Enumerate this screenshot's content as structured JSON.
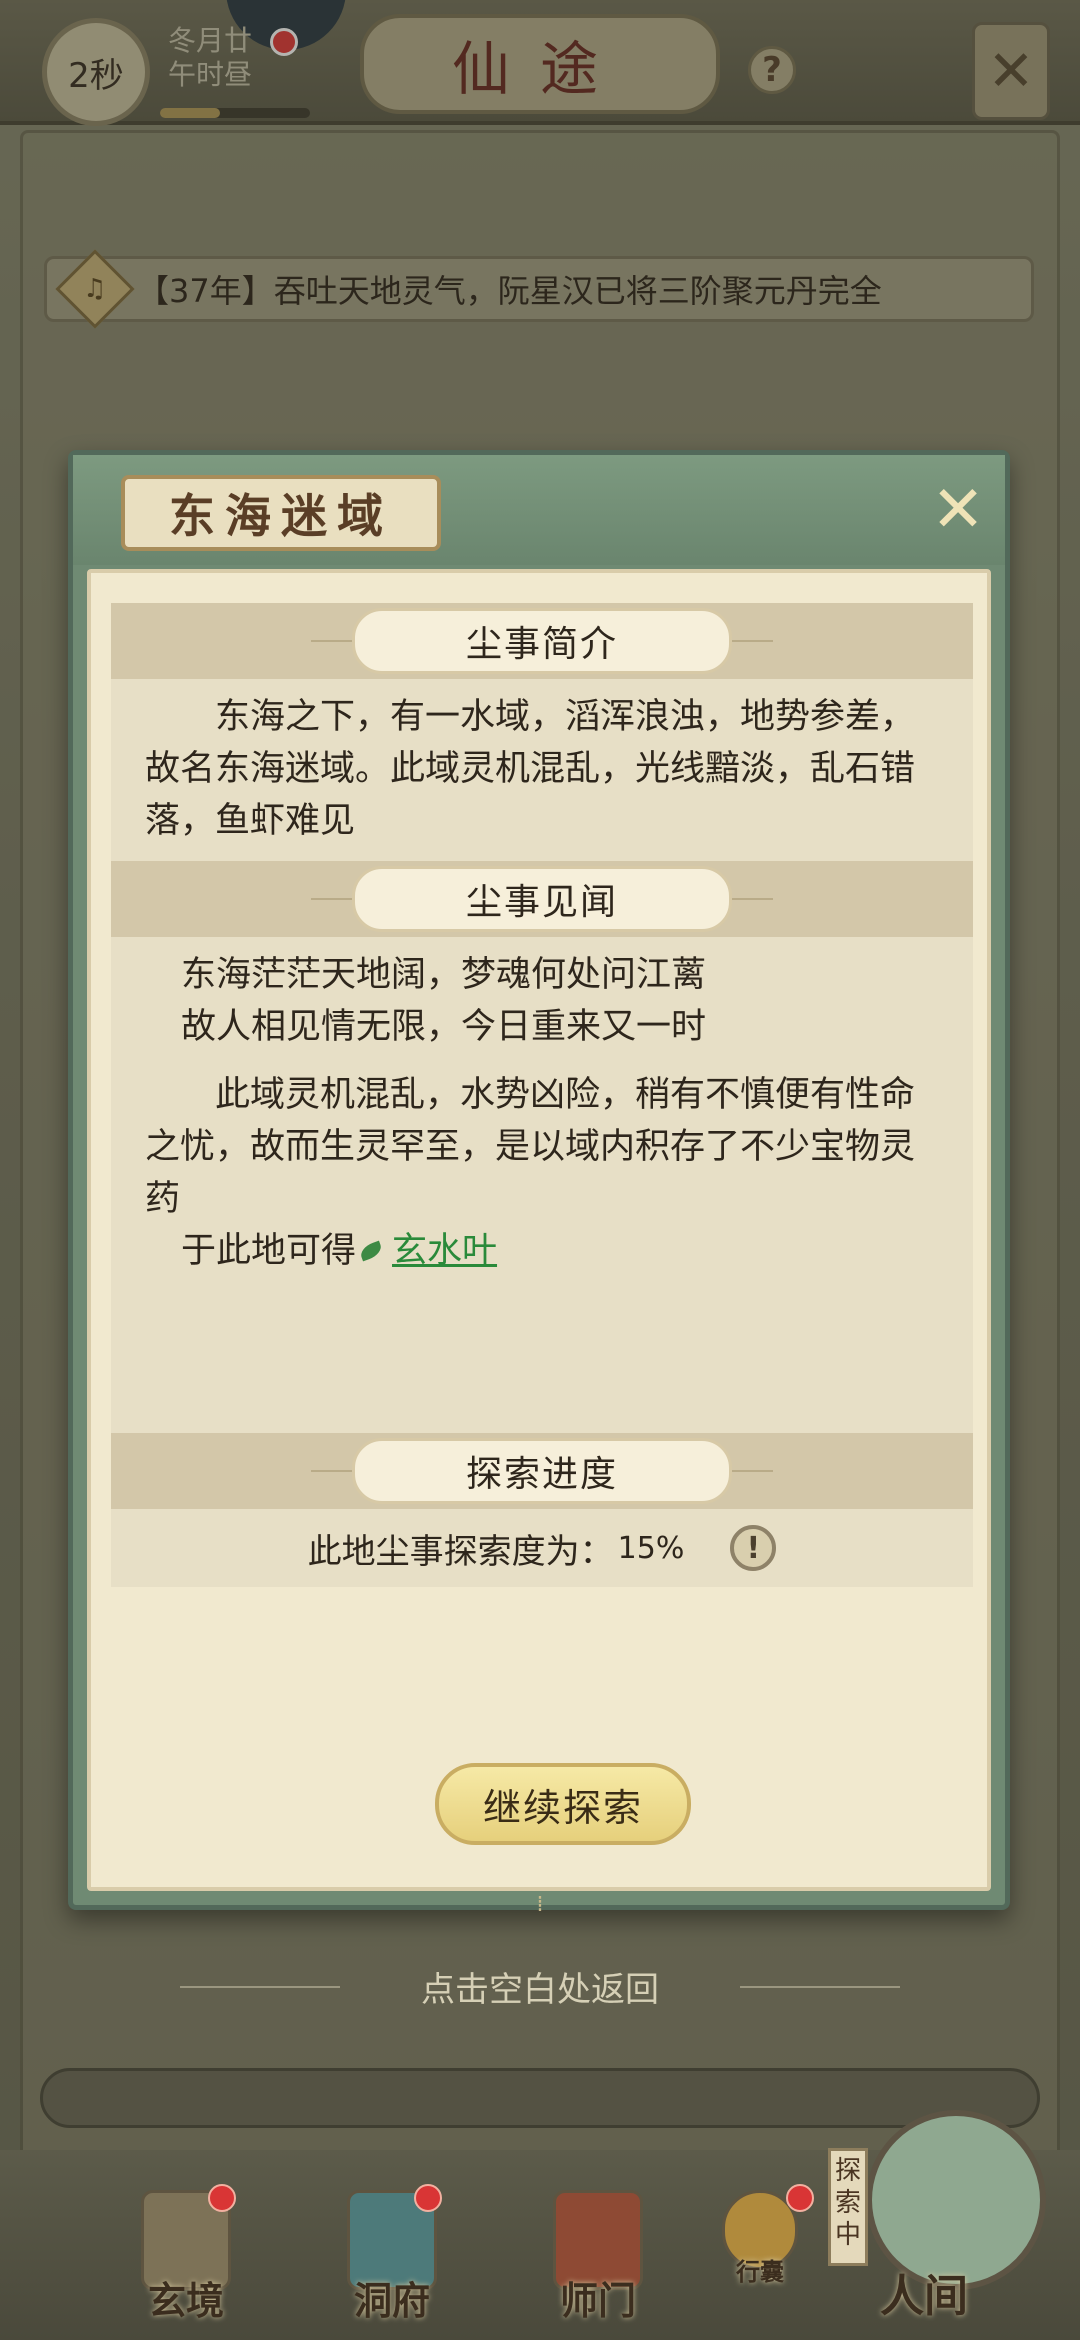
{
  "topbar": {
    "timer": "2秒",
    "date_line1": "冬月廿",
    "date_line2": "午时昼",
    "title": "仙途",
    "help": "?",
    "close": "✕"
  },
  "announcement": {
    "text": "【37年】吞吐天地灵气，阮星汉已将三阶聚元丹完全"
  },
  "dialog": {
    "title": "东海迷域",
    "close": "✕",
    "intro": {
      "heading": "尘事简介",
      "text": "东海之下，有一水域，滔浑浪浊，地势参差，故名东海迷域。此域灵机混乱，光线黯淡，乱石错落，鱼虾难见"
    },
    "lore": {
      "heading": "尘事见闻",
      "poem_line1": "东海茫茫天地阔，梦魂何处问江蓠",
      "poem_line2": "故人相见情无限，今日重来又一时",
      "paragraph": "此域灵机混乱，水势凶险，稍有不慎便有性命之忧，故而生灵罕至，是以域内积存了不少宝物灵药",
      "obtain_prefix": "于此地可得",
      "obtain_item": "玄水叶"
    },
    "progress": {
      "heading": "探索进度",
      "label": "此地尘事探索度为：",
      "value": "15%",
      "value_fraction": 0.15
    },
    "continue_button": "继续探索"
  },
  "hint": "点击空白处返回",
  "bottom_nav": {
    "items": [
      {
        "label": "玄境",
        "badge": true
      },
      {
        "label": "洞府",
        "badge": true
      },
      {
        "label": "师门",
        "badge": false
      },
      {
        "label": "行囊",
        "badge": true
      }
    ],
    "explore_tag": "探索中",
    "main": "人间"
  }
}
